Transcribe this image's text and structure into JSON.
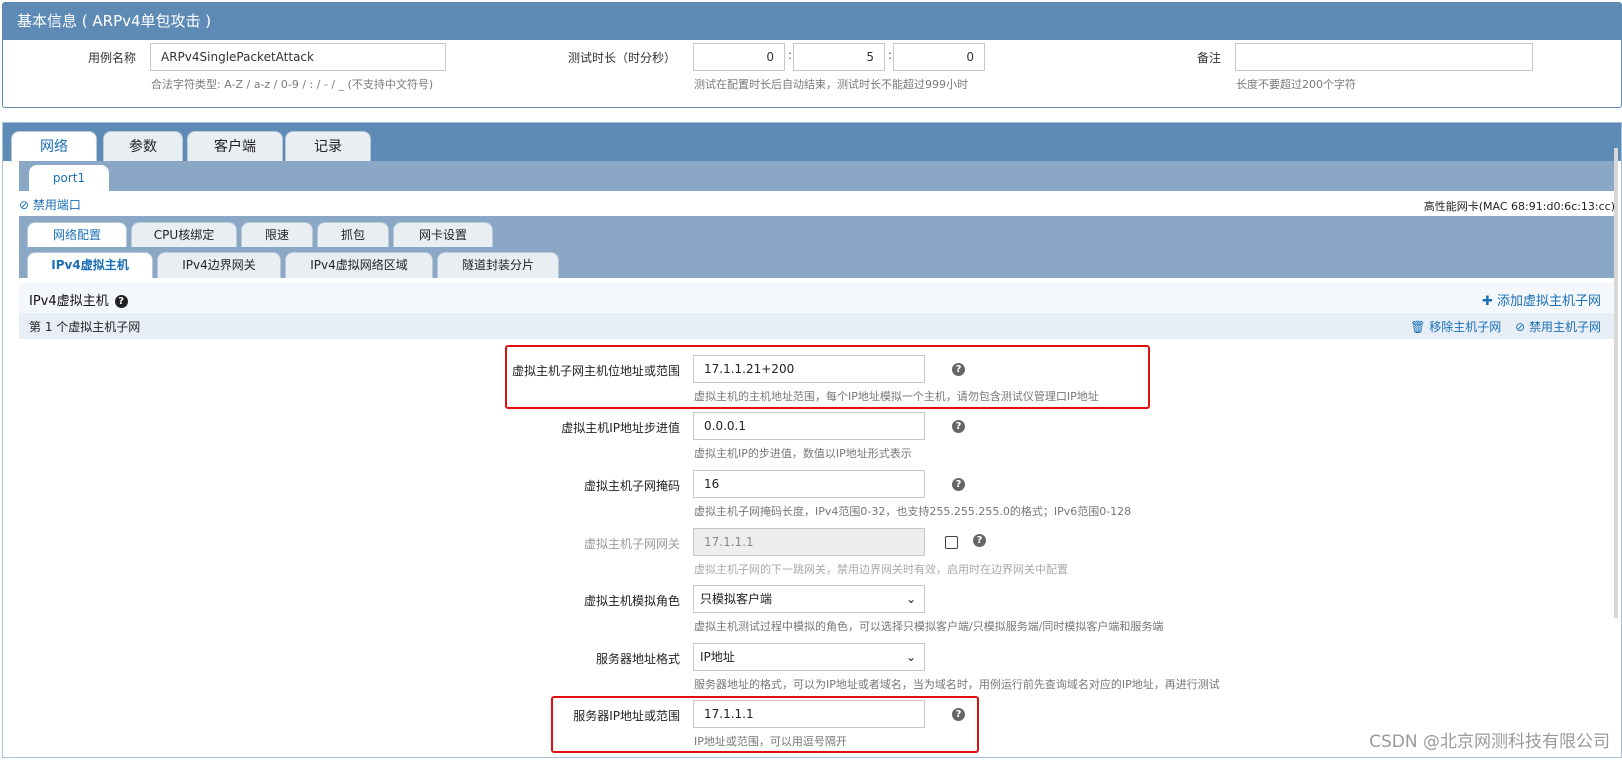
{
  "basic": {
    "header": "基本信息 ( ARPv4单包攻击 )",
    "case_name_label": "用例名称",
    "case_name_value": "ARPv4SinglePacketAttack",
    "case_name_hint": "合法字符类型: A-Z / a-z / 0-9 / : / - / _ (不支持中文符号)",
    "duration_label": "测试时长（时分秒）",
    "duration_h": "0",
    "duration_m": "5",
    "duration_s": "0",
    "colon": ":",
    "duration_hint": "测试在配置时长后自动结束，测试时长不能超过999小时",
    "note_label": "备注",
    "note_value": "",
    "note_hint": "长度不要超过200个字符"
  },
  "main_tabs": [
    "网络",
    "参数",
    "客户端",
    "记录"
  ],
  "port_tab": "port1",
  "disable_port": "⊘ 禁用端口",
  "nic_info": "高性能网卡(MAC 68:91:d0:6c:13:cc)",
  "config_tabs": [
    "网络配置",
    "CPU核绑定",
    "限速",
    "抓包",
    "网卡设置"
  ],
  "ipv4_tabs": [
    "IPv4虚拟主机",
    "IPv4边界网关",
    "IPv4虚拟网络区域",
    "隧道封装分片"
  ],
  "section": {
    "title": "IPv4虚拟主机",
    "add_subnet": "✚ 添加虚拟主机子网",
    "subnet_title": "第 1 个虚拟主机子网",
    "remove_subnet": "🗑 移除主机子网",
    "disable_subnet": "⊘ 禁用主机子网"
  },
  "fields": {
    "host_range_label": "虚拟主机子网主机位地址或范围",
    "host_range_value": "17.1.1.21+200",
    "host_range_hint": "虚拟主机的主机地址范围，每个IP地址模拟一个主机，请勿包含测试仪管理口IP地址",
    "step_label": "虚拟主机IP地址步进值",
    "step_value": "0.0.0.1",
    "step_hint": "虚拟主机IP的步进值，数值以IP地址形式表示",
    "mask_label": "虚拟主机子网掩码",
    "mask_value": "16",
    "mask_hint": "虚拟主机子网掩码长度，IPv4范围0-32，也支持255.255.255.0的格式；IPv6范围0-128",
    "gateway_label": "虚拟主机子网网关",
    "gateway_value": "17.1.1.1",
    "gateway_hint": "虚拟主机子网的下一跳网关，禁用边界网关时有效，启用时在边界网关中配置",
    "role_label": "虚拟主机模拟角色",
    "role_value": "只模拟客户端",
    "role_hint": "虚拟主机测试过程中模拟的角色，可以选择只模拟客户端/只模拟服务端/同时模拟客户端和服务端",
    "server_fmt_label": "服务器地址格式",
    "server_fmt_value": "IP地址",
    "server_fmt_hint": "服务器地址的格式，可以为IP地址或者域名，当为域名时，用例运行前先查询域名对应的IP地址，再进行测试",
    "server_ip_label": "服务器IP地址或范围",
    "server_ip_value": "17.1.1.1",
    "server_ip_hint": "IP地址或范围，可以用逗号隔开"
  },
  "help_glyph": "?",
  "chevron": "⌄",
  "watermark": "CSDN @北京网测科技有限公司",
  "colors": {
    "header_blue": "#5e8bb6",
    "link_blue": "#1a6fb5",
    "highlight_red": "#e01010"
  }
}
